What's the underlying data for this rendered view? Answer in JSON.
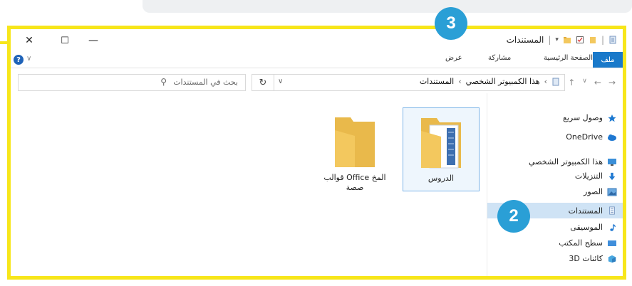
{
  "window": {
    "title": "المستندات",
    "close_glyph": "✕",
    "maximize_glyph": "☐",
    "minimize_glyph": "—"
  },
  "callouts": {
    "first": "3",
    "second": "2"
  },
  "ribbon": {
    "file": "ملف",
    "home": "الصفحة الرئيسية",
    "share": "مشاركة",
    "view": "عرض"
  },
  "address": {
    "crumbs": [
      "هذا الكمبيوتر الشخصي",
      "المستندات"
    ],
    "search_placeholder": "بحث في المستندات"
  },
  "nav": [
    {
      "label": "وصول سريع",
      "icon": "star-icon"
    },
    {
      "label": "OneDrive",
      "icon": "cloud-icon"
    },
    {
      "label": "هذا الكمبيوتر الشخصي",
      "icon": "pc-icon"
    },
    {
      "label": "التنزيلات",
      "icon": "download-icon"
    },
    {
      "label": "الصور",
      "icon": "pictures-icon"
    },
    {
      "label": "المستندات",
      "icon": "documents-icon"
    },
    {
      "label": "الموسيقى",
      "icon": "music-icon"
    },
    {
      "label": "سطح المكتب",
      "icon": "desktop-icon"
    },
    {
      "label": "كائنات 3D",
      "icon": "3d-objects-icon"
    }
  ],
  "files": [
    {
      "label": "الدروس",
      "icon": "folder-with-docs-icon"
    },
    {
      "label_line1": "قوالب Office المخ",
      "label_line2": "صصة",
      "icon": "folder-icon"
    }
  ],
  "colors": {
    "highlight_frame": "#f7e61a",
    "callout": "#2a9fd6",
    "ribbon_file_tab": "#1979ca",
    "nav_selected": "#cfe3f5",
    "folder": "#f3c85e"
  }
}
